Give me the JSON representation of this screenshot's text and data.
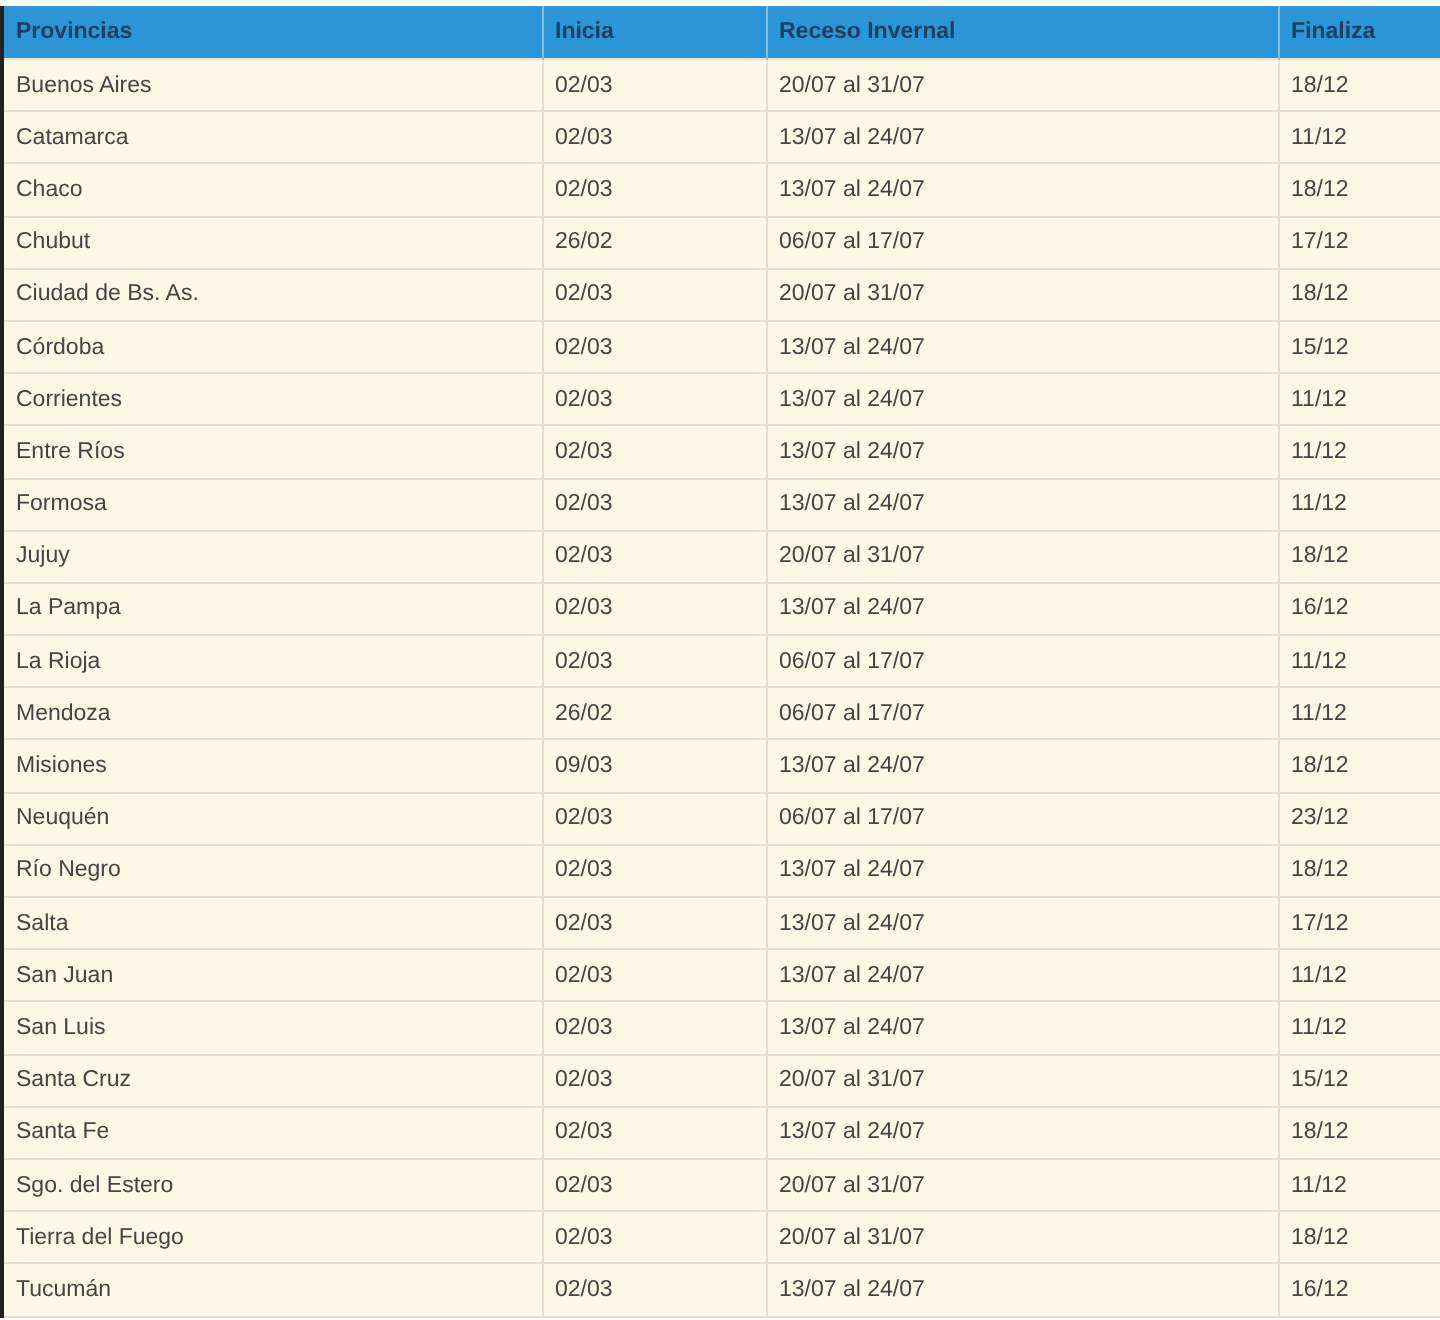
{
  "table": {
    "columns": [
      "Provincias",
      "Inicia",
      "Receso Invernal",
      "Finaliza"
    ],
    "rows": [
      [
        "Buenos Aires",
        "02/03",
        "20/07 al 31/07",
        "18/12"
      ],
      [
        "Catamarca",
        "02/03",
        "13/07 al 24/07",
        "11/12"
      ],
      [
        "Chaco",
        "02/03",
        "13/07 al 24/07",
        "18/12"
      ],
      [
        "Chubut",
        "26/02",
        "06/07 al 17/07",
        "17/12"
      ],
      [
        "Ciudad de Bs. As.",
        "02/03",
        "20/07 al 31/07",
        "18/12"
      ],
      [
        "Córdoba",
        "02/03",
        "13/07 al 24/07",
        "15/12"
      ],
      [
        "Corrientes",
        "02/03",
        "13/07 al 24/07",
        "11/12"
      ],
      [
        "Entre Ríos",
        "02/03",
        "13/07 al 24/07",
        "11/12"
      ],
      [
        "Formosa",
        "02/03",
        "13/07 al 24/07",
        "11/12"
      ],
      [
        "Jujuy",
        "02/03",
        "20/07 al 31/07",
        "18/12"
      ],
      [
        "La Pampa",
        "02/03",
        "13/07 al 24/07",
        "16/12"
      ],
      [
        "La Rioja",
        "02/03",
        "06/07 al 17/07",
        "11/12"
      ],
      [
        "Mendoza",
        "26/02",
        "06/07 al 17/07",
        "11/12"
      ],
      [
        "Misiones",
        "09/03",
        "13/07 al 24/07",
        "18/12"
      ],
      [
        "Neuquén",
        "02/03",
        "06/07 al 17/07",
        "23/12"
      ],
      [
        "Río Negro",
        "02/03",
        "13/07 al 24/07",
        "18/12"
      ],
      [
        "Salta",
        "02/03",
        "13/07 al 24/07",
        "17/12"
      ],
      [
        "San Juan",
        "02/03",
        "13/07 al 24/07",
        "11/12"
      ],
      [
        "San Luis",
        "02/03",
        "13/07 al 24/07",
        "11/12"
      ],
      [
        "Santa Cruz",
        "02/03",
        "20/07 al 31/07",
        "15/12"
      ],
      [
        "Santa Fe",
        "02/03",
        "13/07 al 24/07",
        "18/12"
      ],
      [
        "Sgo. del Estero",
        "02/03",
        "20/07 al 31/07",
        "11/12"
      ],
      [
        "Tierra del Fuego",
        "02/03",
        "20/07 al 31/07",
        "18/12"
      ],
      [
        "Tucumán",
        "02/03",
        "13/07 al 24/07",
        "16/12"
      ]
    ]
  }
}
